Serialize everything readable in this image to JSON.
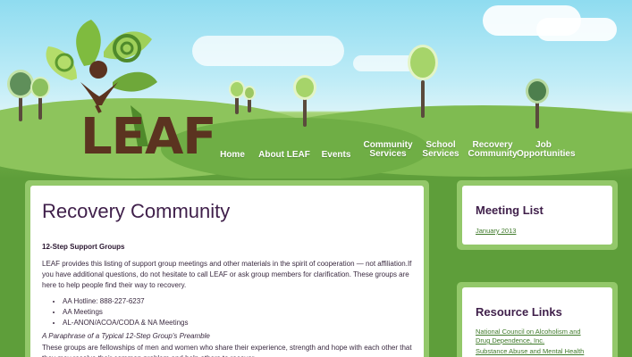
{
  "brand": {
    "logo_text": "LEAF"
  },
  "nav": {
    "items": [
      {
        "lines": [
          "Home"
        ]
      },
      {
        "lines": [
          "About LEAF"
        ]
      },
      {
        "lines": [
          "Events"
        ]
      },
      {
        "lines": [
          "Community",
          "Services"
        ]
      },
      {
        "lines": [
          "School",
          "Services"
        ]
      },
      {
        "lines": [
          "Recovery",
          "Community"
        ]
      },
      {
        "lines": [
          "Job",
          "Opportunities"
        ]
      }
    ]
  },
  "main": {
    "title": "Recovery Community",
    "section_title": "12-Step Support Groups",
    "intro": "LEAF provides this listing of support group meetings and other materials in the spirit of cooperation — not affiliation.If you have additional questions, do not hesitate to call LEAF or ask group members for clarification. These groups are here to help people find their way to recovery.",
    "bullets": [
      "AA Hotline: 888-227-6237",
      "AA Meetings",
      "AL-ANON/ACOA/CODA & NA Meetings"
    ],
    "preamble_heading": "A Paraphrase of a Typical 12-Step Group's Preamble",
    "preamble": "These groups are fellowships of men and women who share their experience, strength and hope with each other that they may resolve their common problem and help others to recover."
  },
  "sidebar": {
    "meeting": {
      "title": "Meeting List",
      "link": "January 2013"
    },
    "resources": {
      "title": "Resource Links",
      "links": [
        [
          "National Council on Alcoholism and",
          "Drug Dependence, Inc."
        ],
        [
          "Substance Abuse and Mental Health"
        ]
      ]
    }
  },
  "colors": {
    "accent": "#3f1f4a",
    "link": "#3f7a2a",
    "background": "#5e9e3a",
    "panel_border": "#93c86a",
    "logo_brown": "#5b3320"
  }
}
